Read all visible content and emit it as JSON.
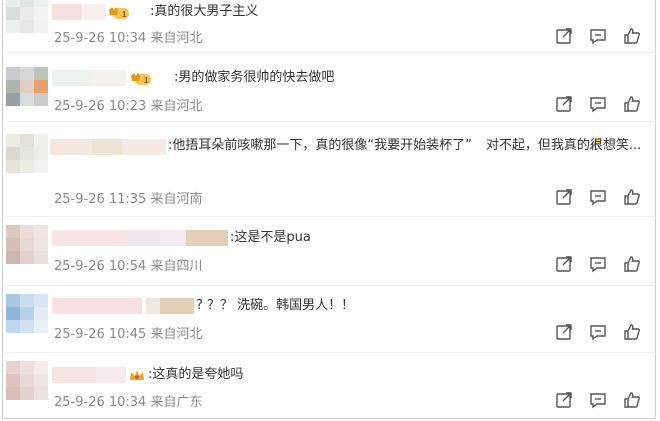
{
  "comments": [
    {
      "text": ":真的很大男子主义",
      "date": "25-9-26 10:34",
      "location": "来自河北",
      "badge": "VIP 1"
    },
    {
      "text": ":男的做家务很帅的快去做吧",
      "date": "25-9-26 10:23",
      "location": "来自河北",
      "badge": "VIP 1"
    },
    {
      "text_a": ":他捂耳朵前咳嗽那一下，真的很像“我要开始装杯了”",
      "text_b": "对不起，但我真的很想笑...",
      "date": "25-9-26 11:35",
      "location": "来自河南"
    },
    {
      "text": ":这是不是pua",
      "date": "25-9-26 10:54",
      "location": "来自四川"
    },
    {
      "text": "? ？？ 洗碗。韩国男人！！",
      "date": "25-9-26 10:45",
      "location": "来自河北"
    },
    {
      "text": ":这真的是夸她吗",
      "date": "25-9-26 10:34",
      "location": "来自广东"
    }
  ],
  "actions": {
    "icons": [
      "share-icon",
      "comment-icon",
      "like-icon"
    ]
  },
  "colors": {
    "text": "#333333",
    "meta": "#8a8a8a",
    "icon": "#555555",
    "badge_gold": "#f0a81a"
  }
}
